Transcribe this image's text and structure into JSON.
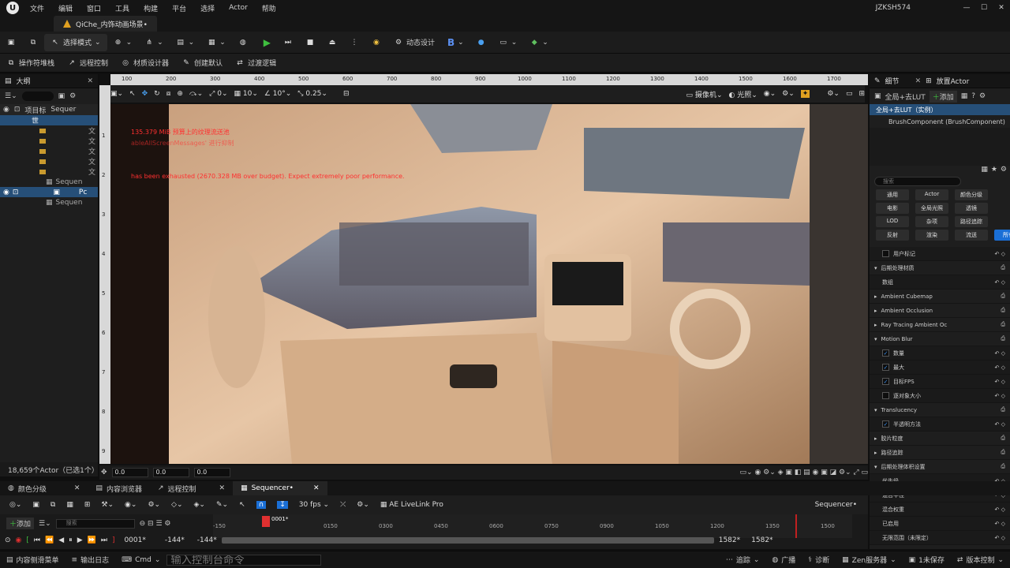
{
  "menubar": {
    "logo": "U",
    "items": [
      "文件",
      "编辑",
      "窗口",
      "工具",
      "构建",
      "平台",
      "选择",
      "Actor",
      "帮助"
    ],
    "user": "JZKSH574"
  },
  "doc_tab": {
    "label": "QiChe_内饰动画场景•"
  },
  "toolbar": {
    "mode_label": "选择模式",
    "dynamic_design": "动态设计",
    "b_label": "B"
  },
  "toolbar2": {
    "items": [
      "操作符堆栈",
      "远程控制",
      "材质设计器",
      "创建默认",
      "过渡逻辑"
    ]
  },
  "outliner": {
    "title": "大纲",
    "columns": [
      "项目标",
      "Sequer"
    ],
    "rows": [
      {
        "label": "世",
        "folder": false,
        "sel": true
      },
      {
        "label": "文",
        "folder": true
      },
      {
        "label": "文",
        "folder": true
      },
      {
        "label": "文",
        "folder": true
      },
      {
        "label": "文",
        "folder": true
      },
      {
        "label": "文",
        "folder": true
      },
      {
        "label": "Sequen",
        "folder": false
      },
      {
        "label": "Pc",
        "folder": false,
        "sel": true
      },
      {
        "label": "Sequen",
        "folder": false
      }
    ],
    "status": "18,659个Actor（已选1个）"
  },
  "viewport": {
    "ruler_top": [
      "100",
      "200",
      "300",
      "400",
      "500",
      "600",
      "700",
      "800",
      "900",
      "1000",
      "1100",
      "1200",
      "1300",
      "1400",
      "1500",
      "1600",
      "1700"
    ],
    "ruler_left": [
      "1",
      "2",
      "3",
      "4",
      "5",
      "6",
      "7",
      "8",
      "9"
    ],
    "snap_angle": "0",
    "snap_grid": "10",
    "rot_grid": "10°",
    "scale": "0.25",
    "camera": "摄像机",
    "lighting": "光照",
    "msg1": "135.379 MiB 预算上的纹理流送池",
    "msg1b": "ableAllScreenMessages' 进行抑制",
    "msg2": "has been exhausted (2670.328 MB over budget). Expect extremely poor performance.",
    "coords": [
      "0.0",
      "0.0",
      "0.0"
    ]
  },
  "details": {
    "tab1": "细节",
    "tab2": "放置Actor",
    "actor": "全局+去LUT",
    "add": "添加",
    "comp_root": "全局+去LUT（实例）",
    "comp_child": "BrushComponent (BrushComponent)",
    "search": "搜索",
    "filters": [
      [
        "通用",
        "Actor",
        "颜色分级"
      ],
      [
        "电影",
        "全局光照",
        "透镜"
      ],
      [
        "LOD",
        "杂项",
        "路径追踪"
      ],
      [
        "反射",
        "渲染",
        "流送",
        "所有"
      ]
    ],
    "rows": [
      {
        "t": "prop",
        "label": "用户标记",
        "cb": false
      },
      {
        "t": "cat",
        "label": "后期处理材质"
      },
      {
        "t": "prop",
        "label": "数组"
      },
      {
        "t": "cat",
        "label": "Ambient Cubemap"
      },
      {
        "t": "cat",
        "label": "Ambient Occlusion"
      },
      {
        "t": "cat",
        "label": "Ray Tracing Ambient Oc"
      },
      {
        "t": "cat",
        "label": "Motion Blur"
      },
      {
        "t": "prop",
        "label": "数量",
        "cb": true
      },
      {
        "t": "prop",
        "label": "最大",
        "cb": true
      },
      {
        "t": "prop",
        "label": "目标FPS",
        "cb": true
      },
      {
        "t": "prop",
        "label": "逐对象大小",
        "cb": false
      },
      {
        "t": "cat",
        "label": "Translucency"
      },
      {
        "t": "prop",
        "label": "半透明方法",
        "cb": true
      },
      {
        "t": "cat",
        "label": "胶片粒度"
      },
      {
        "t": "cat",
        "label": "路径追踪"
      },
      {
        "t": "cat",
        "label": "后期处理体积设置"
      },
      {
        "t": "prop",
        "label": "优先级"
      },
      {
        "t": "prop",
        "label": "混合半径"
      },
      {
        "t": "prop",
        "label": "混合权重"
      },
      {
        "t": "prop",
        "label": "已启用"
      },
      {
        "t": "prop",
        "label": "无限范围（未限定）"
      }
    ]
  },
  "bottom_tabs": [
    "颜色分级",
    "内容浏览器",
    "远程控制",
    "Sequencer•"
  ],
  "sequencer": {
    "add": "添加",
    "search": "搜索",
    "fps": "30 fps",
    "livelink": "AE LiveLink Pro",
    "name": "Sequencer•",
    "ticks": [
      "-150",
      "0150",
      "0300",
      "0450",
      "0600",
      "0750",
      "0900",
      "1050",
      "1200",
      "1350",
      "1500"
    ],
    "playhead": "0001*",
    "frame": "0001*",
    "start": "-144*",
    "start2": "-144*",
    "end": "1582*",
    "end2": "1582*"
  },
  "statusbar": {
    "drawer": "内容侧滑菜单",
    "log": "输出日志",
    "cmd": "Cmd",
    "cmd_placeholder": "输入控制台命令",
    "trace": "追踪",
    "broadcast": "广播",
    "diag": "诊断",
    "zen": "Zen服务器",
    "save": "1未保存",
    "vcs": "版本控制"
  }
}
